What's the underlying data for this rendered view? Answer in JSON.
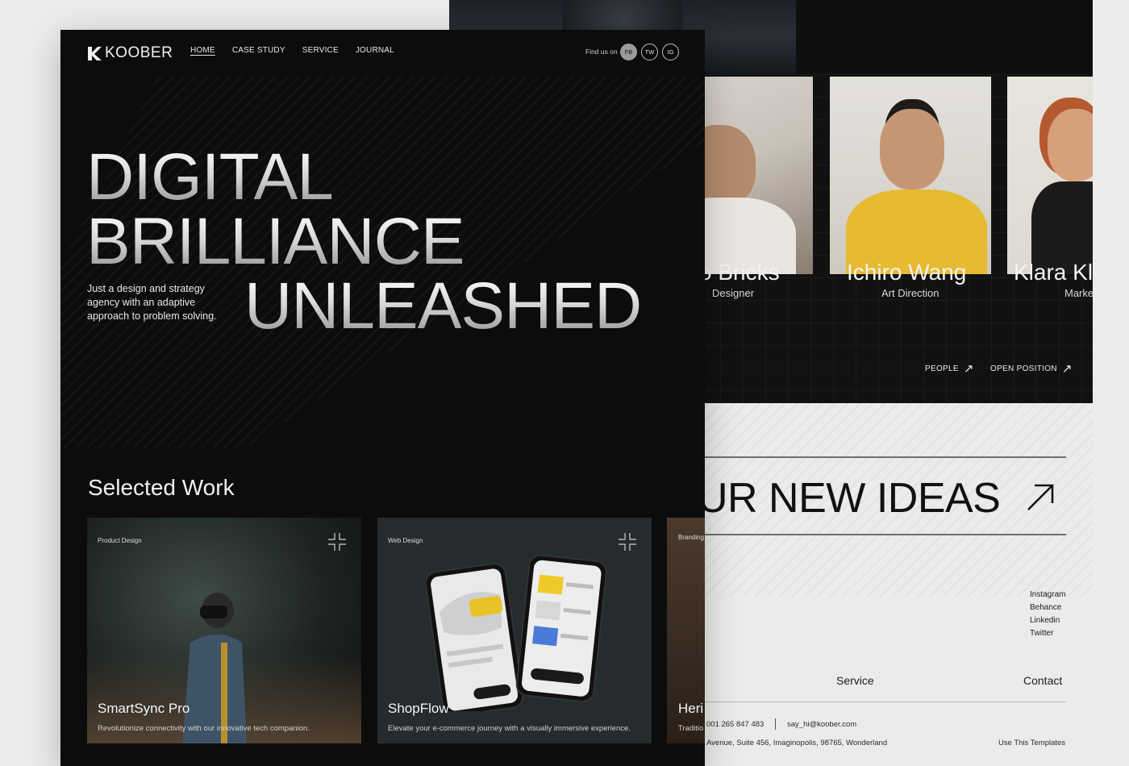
{
  "brand": {
    "name": "KOOBER"
  },
  "nav": {
    "items": [
      "HOME",
      "CASE STUDY",
      "SERVICE",
      "JOURNAL"
    ],
    "active": "HOME"
  },
  "social_header": {
    "label": "Find us on",
    "items": [
      "FB",
      "TW",
      "IG"
    ]
  },
  "hero": {
    "lines": [
      "DIGITAL",
      "BRILLIANCE",
      "UNLEASHED"
    ],
    "tagline": "Just a design and strategy agency with an adaptive approach to problem solving."
  },
  "selected_work": {
    "title": "Selected Work",
    "items": [
      {
        "category": "Product Design",
        "title": "SmartSync Pro",
        "desc": "Revolutionize connectivity with our innovative tech companion."
      },
      {
        "category": "Web Design",
        "title": "ShopFlow",
        "desc": "Elevate your e-commerce journey with a visually immersive experience."
      },
      {
        "category": "Branding",
        "title": "Heri",
        "desc": "Traditio"
      }
    ]
  },
  "team": {
    "members": [
      {
        "name": "o Bricks",
        "role": "Designer"
      },
      {
        "name": "Ichiro Wang",
        "role": "Art Direction"
      },
      {
        "name": "Klara Kl",
        "role": "Marke"
      }
    ],
    "links": [
      "PEOPLE",
      "OPEN POSITION"
    ]
  },
  "footer": {
    "headline": "UR NEW IDEAS",
    "socials": [
      "Instagram",
      "Behance",
      "Linkedin",
      "Twitter"
    ],
    "nav": [
      "Service",
      "Contact"
    ],
    "phone": "001 265 847 483",
    "email": "say_hi@koober.com",
    "address": "Avenue, Suite 456, Imaginopolis, 98765, Wonderland",
    "cta": "Use This Templates"
  },
  "colors": {
    "bg": "#0c0c0c",
    "footer_bg": "#ebebea",
    "text": "#f0f0f0"
  }
}
